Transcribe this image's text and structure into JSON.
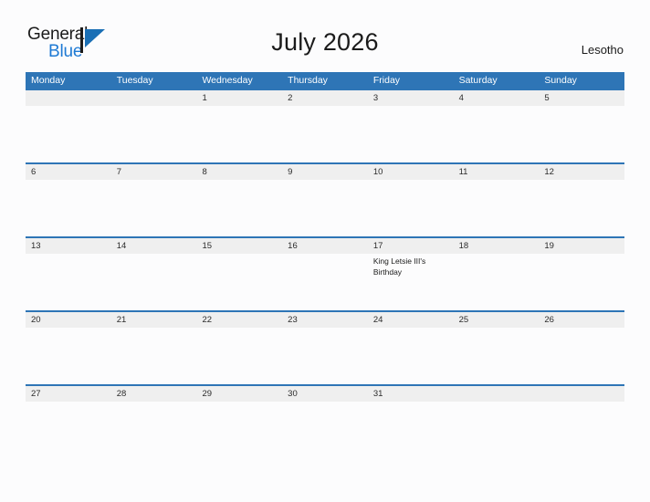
{
  "brand": {
    "name_top": "General",
    "name_bottom": "Blue",
    "flag_icon": "flag-triangle-icon",
    "color_text": "#1b1b1b",
    "color_blue": "#1e7ad4"
  },
  "header": {
    "title": "July 2026",
    "country": "Lesotho"
  },
  "theme": {
    "header_blue": "#2e75b6",
    "row_band_gray": "#efefef",
    "page_background": "#fcfcfd",
    "text_dark": "#1b1b1b"
  },
  "calendar": {
    "weekdays": [
      "Monday",
      "Tuesday",
      "Wednesday",
      "Thursday",
      "Friday",
      "Saturday",
      "Sunday"
    ],
    "weeks": [
      {
        "days": [
          {
            "num": "",
            "event": ""
          },
          {
            "num": "",
            "event": ""
          },
          {
            "num": "1",
            "event": ""
          },
          {
            "num": "2",
            "event": ""
          },
          {
            "num": "3",
            "event": ""
          },
          {
            "num": "4",
            "event": ""
          },
          {
            "num": "5",
            "event": ""
          }
        ]
      },
      {
        "days": [
          {
            "num": "6",
            "event": ""
          },
          {
            "num": "7",
            "event": ""
          },
          {
            "num": "8",
            "event": ""
          },
          {
            "num": "9",
            "event": ""
          },
          {
            "num": "10",
            "event": ""
          },
          {
            "num": "11",
            "event": ""
          },
          {
            "num": "12",
            "event": ""
          }
        ]
      },
      {
        "days": [
          {
            "num": "13",
            "event": ""
          },
          {
            "num": "14",
            "event": ""
          },
          {
            "num": "15",
            "event": ""
          },
          {
            "num": "16",
            "event": ""
          },
          {
            "num": "17",
            "event": "King Letsie III's Birthday"
          },
          {
            "num": "18",
            "event": ""
          },
          {
            "num": "19",
            "event": ""
          }
        ]
      },
      {
        "days": [
          {
            "num": "20",
            "event": ""
          },
          {
            "num": "21",
            "event": ""
          },
          {
            "num": "22",
            "event": ""
          },
          {
            "num": "23",
            "event": ""
          },
          {
            "num": "24",
            "event": ""
          },
          {
            "num": "25",
            "event": ""
          },
          {
            "num": "26",
            "event": ""
          }
        ]
      },
      {
        "days": [
          {
            "num": "27",
            "event": ""
          },
          {
            "num": "28",
            "event": ""
          },
          {
            "num": "29",
            "event": ""
          },
          {
            "num": "30",
            "event": ""
          },
          {
            "num": "31",
            "event": ""
          },
          {
            "num": "",
            "event": ""
          },
          {
            "num": "",
            "event": ""
          }
        ]
      }
    ]
  }
}
